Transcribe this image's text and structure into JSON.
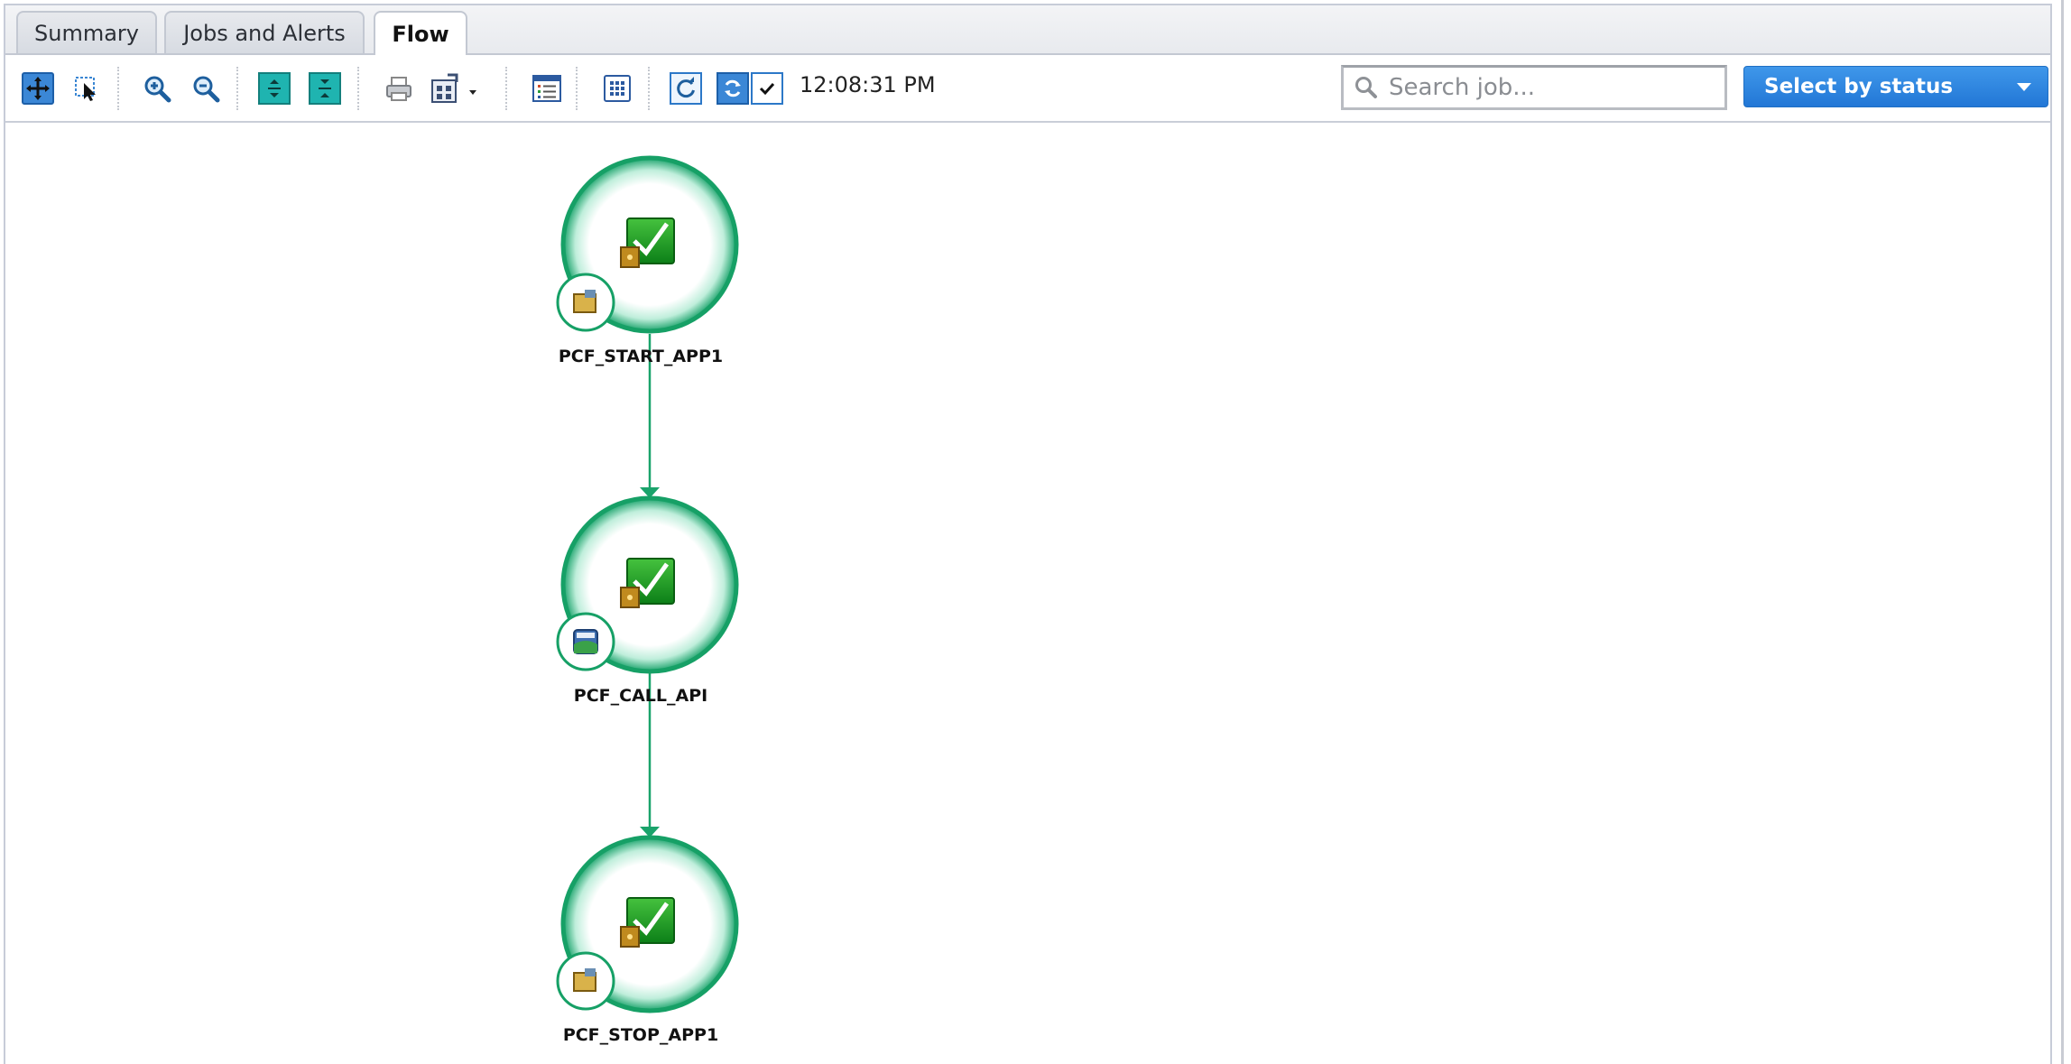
{
  "tabs": [
    {
      "label": "Summary",
      "active": false
    },
    {
      "label": "Jobs and Alerts",
      "active": false
    },
    {
      "label": "Flow",
      "active": true
    }
  ],
  "toolbar": {
    "time": "12:08:31 PM",
    "search_placeholder": "Search job...",
    "status_select_label": "Select by status",
    "icons": [
      "pan-icon",
      "select-icon",
      "zoom-in-icon",
      "zoom-out-icon",
      "collapse-icon",
      "expand-icon",
      "print-icon",
      "export-icon",
      "list-view-icon",
      "grid-icon",
      "refresh-icon",
      "auto-refresh-icon",
      "checkbox-icon"
    ]
  },
  "flow": {
    "nodes": [
      {
        "name": "PCF_START_APP1",
        "status": "completed",
        "type_icon": "folder-script-icon"
      },
      {
        "name": "PCF_CALL_API",
        "status": "completed",
        "type_icon": "web-service-icon"
      },
      {
        "name": "PCF_STOP_APP1",
        "status": "completed",
        "type_icon": "folder-script-icon"
      }
    ],
    "colors": {
      "node_ring": "#1aa36b",
      "edge": "#1aa36b",
      "status_green": "#129a2a"
    }
  }
}
